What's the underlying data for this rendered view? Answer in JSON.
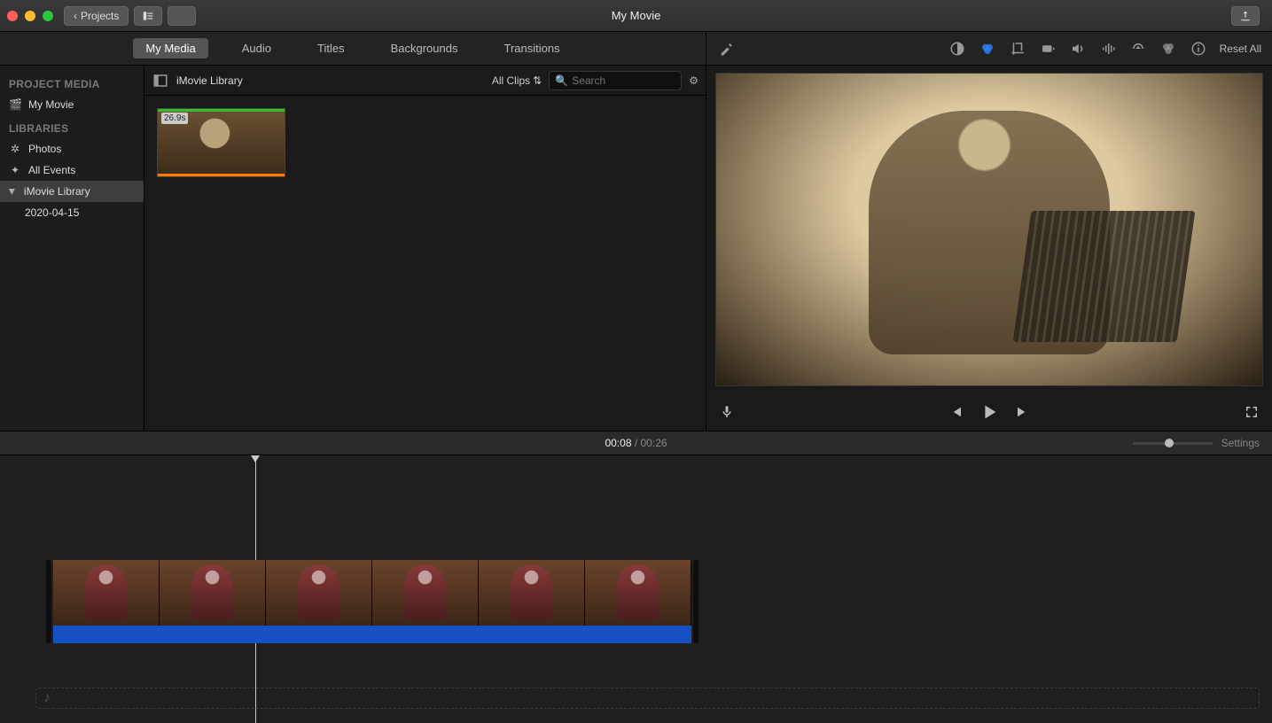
{
  "titlebar": {
    "projects_label": "Projects",
    "title": "My Movie"
  },
  "tabs": {
    "items": [
      "My Media",
      "Audio",
      "Titles",
      "Backgrounds",
      "Transitions"
    ],
    "active_index": 0
  },
  "adjust": {
    "reset_label": "Reset All",
    "tools": [
      "enhance",
      "color-balance",
      "color-correction",
      "crop",
      "stabilize",
      "volume",
      "noise",
      "speed",
      "filter",
      "info"
    ],
    "active_tool_index": 2
  },
  "sidebar": {
    "project_media_head": "PROJECT MEDIA",
    "project_item": "My Movie",
    "libraries_head": "LIBRARIES",
    "photos": "Photos",
    "all_events": "All Events",
    "library": "iMovie Library",
    "event_date": "2020-04-15"
  },
  "browser": {
    "breadcrumb": "iMovie Library",
    "clips_dd": "All Clips",
    "search_placeholder": "Search",
    "clip_duration": "26.9s"
  },
  "timeline": {
    "current": "00:08",
    "total": "00:26",
    "settings_label": "Settings"
  }
}
